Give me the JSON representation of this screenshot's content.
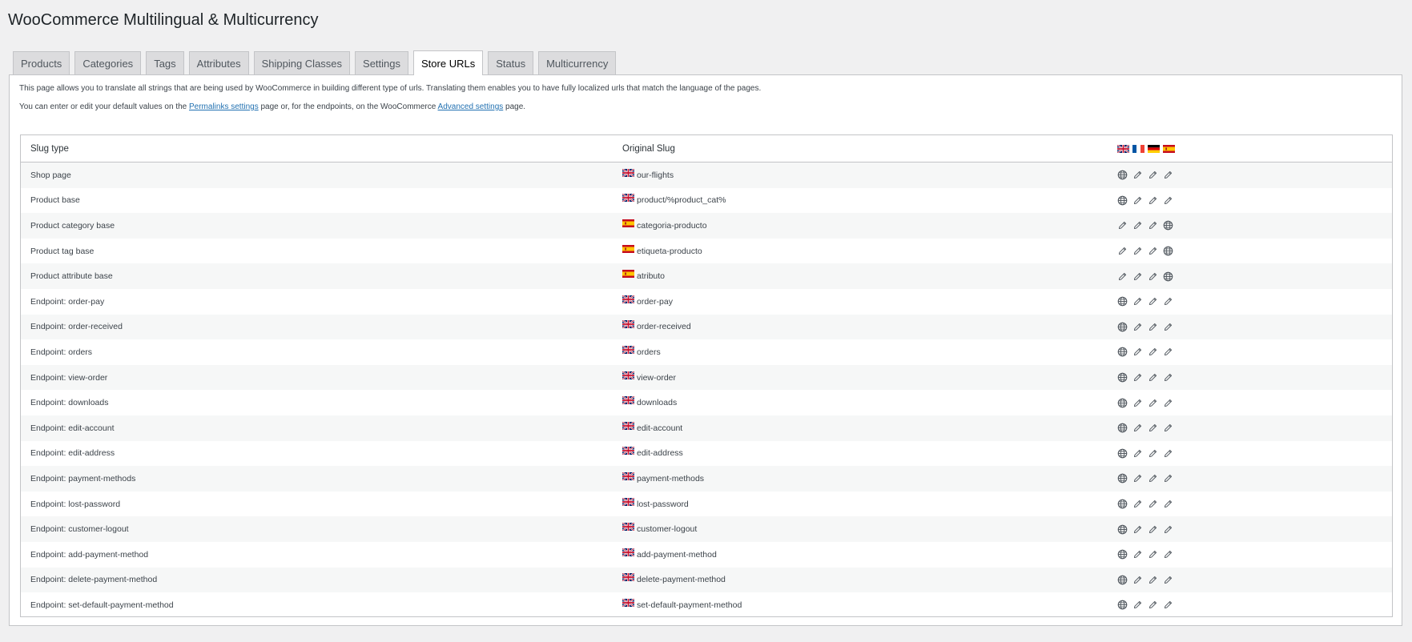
{
  "page": {
    "title": "WooCommerce Multilingual & Multicurrency"
  },
  "tabs": [
    {
      "label": "Products",
      "active": false
    },
    {
      "label": "Categories",
      "active": false
    },
    {
      "label": "Tags",
      "active": false
    },
    {
      "label": "Attributes",
      "active": false
    },
    {
      "label": "Shipping Classes",
      "active": false
    },
    {
      "label": "Settings",
      "active": false
    },
    {
      "label": "Store URLs",
      "active": true
    },
    {
      "label": "Status",
      "active": false
    },
    {
      "label": "Multicurrency",
      "active": false
    }
  ],
  "intro": {
    "line1": "This page allows you to translate all strings that are being used by WooCommerce in building different type of urls. Translating them enables you to have fully localized urls that match the language of the pages.",
    "line2_pre": "You can enter or edit your default values on the ",
    "permalinks_link": "Permalinks settings",
    "line2_mid": " page or, for the endpoints, on the WooCommerce ",
    "advanced_link": "Advanced settings",
    "line2_post": " page."
  },
  "table": {
    "col_slug_type": "Slug type",
    "col_original_slug": "Original Slug",
    "languages": [
      {
        "code": "en",
        "icon": "flag-uk-icon"
      },
      {
        "code": "fr",
        "icon": "flag-fr-icon"
      },
      {
        "code": "de",
        "icon": "flag-de-icon"
      },
      {
        "code": "es",
        "icon": "flag-es-icon"
      }
    ],
    "rows": [
      {
        "slug_type": "Shop page",
        "flag": "uk",
        "original": "our-flights",
        "status": [
          "globe",
          "pencil",
          "pencil",
          "pencil"
        ]
      },
      {
        "slug_type": "Product base",
        "flag": "uk",
        "original": "product/%product_cat%",
        "status": [
          "globe",
          "pencil",
          "pencil",
          "pencil"
        ]
      },
      {
        "slug_type": "Product category base",
        "flag": "es",
        "original": "categoria-producto",
        "status": [
          "pencil",
          "pencil",
          "pencil",
          "globe"
        ]
      },
      {
        "slug_type": "Product tag base",
        "flag": "es",
        "original": "etiqueta-producto",
        "status": [
          "pencil",
          "pencil",
          "pencil",
          "globe"
        ]
      },
      {
        "slug_type": "Product attribute base",
        "flag": "es",
        "original": "atributo",
        "status": [
          "pencil",
          "pencil",
          "pencil",
          "globe"
        ]
      },
      {
        "slug_type": "Endpoint: order-pay",
        "flag": "uk",
        "original": "order-pay",
        "status": [
          "globe",
          "pencil",
          "pencil",
          "pencil"
        ]
      },
      {
        "slug_type": "Endpoint: order-received",
        "flag": "uk",
        "original": "order-received",
        "status": [
          "globe",
          "pencil",
          "pencil",
          "pencil"
        ]
      },
      {
        "slug_type": "Endpoint: orders",
        "flag": "uk",
        "original": "orders",
        "status": [
          "globe",
          "pencil",
          "pencil",
          "pencil"
        ]
      },
      {
        "slug_type": "Endpoint: view-order",
        "flag": "uk",
        "original": "view-order",
        "status": [
          "globe",
          "pencil",
          "pencil",
          "pencil"
        ]
      },
      {
        "slug_type": "Endpoint: downloads",
        "flag": "uk",
        "original": "downloads",
        "status": [
          "globe",
          "pencil",
          "pencil",
          "pencil"
        ]
      },
      {
        "slug_type": "Endpoint: edit-account",
        "flag": "uk",
        "original": "edit-account",
        "status": [
          "globe",
          "pencil",
          "pencil",
          "pencil"
        ]
      },
      {
        "slug_type": "Endpoint: edit-address",
        "flag": "uk",
        "original": "edit-address",
        "status": [
          "globe",
          "pencil",
          "pencil",
          "pencil"
        ]
      },
      {
        "slug_type": "Endpoint: payment-methods",
        "flag": "uk",
        "original": "payment-methods",
        "status": [
          "globe",
          "pencil",
          "pencil",
          "pencil"
        ]
      },
      {
        "slug_type": "Endpoint: lost-password",
        "flag": "uk",
        "original": "lost-password",
        "status": [
          "globe",
          "pencil",
          "pencil",
          "pencil"
        ]
      },
      {
        "slug_type": "Endpoint: customer-logout",
        "flag": "uk",
        "original": "customer-logout",
        "status": [
          "globe",
          "pencil",
          "pencil",
          "pencil"
        ]
      },
      {
        "slug_type": "Endpoint: add-payment-method",
        "flag": "uk",
        "original": "add-payment-method",
        "status": [
          "globe",
          "pencil",
          "pencil",
          "pencil"
        ]
      },
      {
        "slug_type": "Endpoint: delete-payment-method",
        "flag": "uk",
        "original": "delete-payment-method",
        "status": [
          "globe",
          "pencil",
          "pencil",
          "pencil"
        ]
      },
      {
        "slug_type": "Endpoint: set-default-payment-method",
        "flag": "uk",
        "original": "set-default-payment-method",
        "status": [
          "globe",
          "pencil",
          "pencil",
          "pencil"
        ]
      }
    ]
  },
  "colors": {
    "link": "#2271b1",
    "icon": "#50575e"
  }
}
